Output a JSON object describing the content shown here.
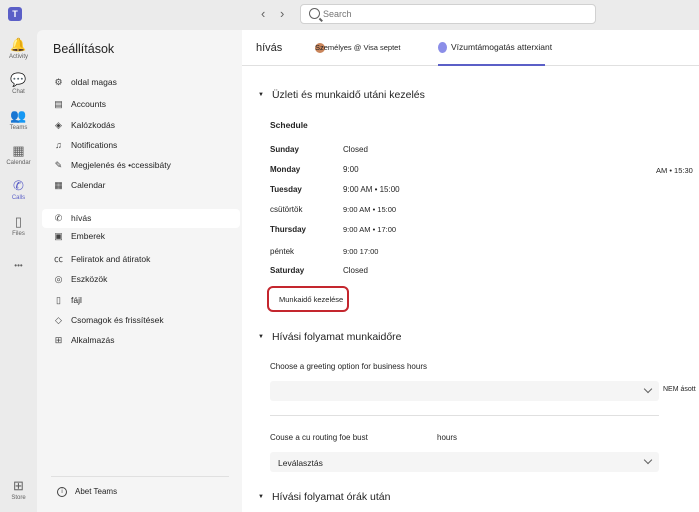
{
  "topbar": {
    "app_logo": "T",
    "search_placeholder": "Search",
    "back_glyph": "‹",
    "forward_glyph": "›"
  },
  "rail": {
    "items": [
      {
        "label": "Activity",
        "icon": "bell-icon",
        "glyph": "🔔"
      },
      {
        "label": "Chat",
        "icon": "chat-icon",
        "glyph": "💬"
      },
      {
        "label": "Teams",
        "icon": "teams-icon",
        "glyph": "👥"
      },
      {
        "label": "Calendar",
        "icon": "calendar-icon",
        "glyph": "▦"
      },
      {
        "label": "Calls",
        "icon": "phone-icon",
        "glyph": "✆"
      },
      {
        "label": "Files",
        "icon": "file-icon",
        "glyph": "▯"
      },
      {
        "label": "",
        "icon": "more-icon",
        "glyph": "•••"
      },
      {
        "label": "Store",
        "icon": "store-icon",
        "glyph": "⊞"
      }
    ]
  },
  "settings": {
    "title": "Beállítások",
    "items": [
      {
        "label": "oldal magas",
        "icon": "gear-icon",
        "glyph": "⚙"
      },
      {
        "label": "Accounts",
        "icon": "accounts-icon",
        "glyph": "▤"
      },
      {
        "label": "Kalózkodás",
        "icon": "shield-icon",
        "glyph": "◈"
      },
      {
        "label": "Notifications",
        "icon": "bell-icon",
        "glyph": "♫"
      },
      {
        "label": "Megjelenés és •ccessibáty",
        "icon": "wand-icon",
        "glyph": "✎"
      },
      {
        "label": "Calendar",
        "icon": "calendar-icon",
        "glyph": "▦"
      },
      {
        "label": "hívás",
        "icon": "phone-icon",
        "glyph": "✆"
      },
      {
        "label": "Emberek",
        "icon": "people-icon",
        "glyph": "▣"
      },
      {
        "label": "Feliratok and átiratok",
        "icon": "captions-icon",
        "glyph": "㏄"
      },
      {
        "label": "Eszközök",
        "icon": "headset-icon",
        "glyph": "◎"
      },
      {
        "label": "fájl",
        "icon": "file-icon",
        "glyph": "▯"
      },
      {
        "label": "Csomagok és frissítések",
        "icon": "diamond-icon",
        "glyph": "◇"
      },
      {
        "label": "Alkalmazás",
        "icon": "apps-icon",
        "glyph": "⊞"
      }
    ],
    "about_label": "Abet Teams",
    "about_glyph": "i"
  },
  "main": {
    "tab_title": "hívás",
    "tab_user": "Személyes @ Visa septet",
    "tab_assist": "Vízumtámogatás atterxiant",
    "section1": "Üzleti és munkaidő utáni kezelés",
    "schedule_label": "Schedule",
    "schedule": [
      {
        "day": "Sunday",
        "time": "Closed",
        "bold": true
      },
      {
        "day": "Monday",
        "time": "9:00",
        "bold": true
      },
      {
        "day": "Tuesday",
        "time": "9:00 AM • 15:00",
        "bold": true
      },
      {
        "day": "csütörtök",
        "time": "9:00 AM • 15:00",
        "bold": false
      },
      {
        "day": "Thursday",
        "time": "9:00 AM • 17:00",
        "bold": true
      },
      {
        "day": "péntek",
        "time": "9:00 17:00",
        "bold": false
      },
      {
        "day": "Saturday",
        "time": "Closed",
        "bold": true
      }
    ],
    "monday_overflow": "AM • 15:30",
    "manage_button": "Munkaidő kezelése",
    "section2": "Hívási folyamat munkaidőre",
    "greeting_label": "Choose a greeting option for business hours",
    "greeting_value": "",
    "greeting_note": "NEM ásott",
    "routing_label": "Couse a cu routing foe bust",
    "routing_hours": "hours",
    "routing_value": "Leválasztás",
    "section3": "Hívási folyamat órák után",
    "caret": "▼"
  }
}
